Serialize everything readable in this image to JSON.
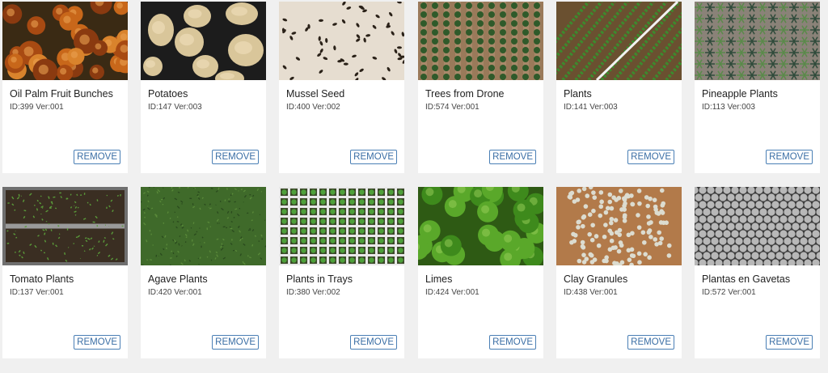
{
  "datasets": [
    {
      "title": "Oil Palm Fruit Bunches",
      "meta": "ID:399 Ver:001",
      "remove_label": "REMOVE",
      "thumb": "oil-palm"
    },
    {
      "title": "Potatoes",
      "meta": "ID:147 Ver:003",
      "remove_label": "REMOVE",
      "thumb": "potatoes"
    },
    {
      "title": "Mussel Seed",
      "meta": "ID:400 Ver:002",
      "remove_label": "REMOVE",
      "thumb": "mussel"
    },
    {
      "title": "Trees from Drone",
      "meta": "ID:574 Ver:001",
      "remove_label": "REMOVE",
      "thumb": "trees"
    },
    {
      "title": "Plants",
      "meta": "ID:141 Ver:003",
      "remove_label": "REMOVE",
      "thumb": "plants"
    },
    {
      "title": "Pineapple Plants",
      "meta": "ID:113 Ver:003",
      "remove_label": "REMOVE",
      "thumb": "pineapple"
    },
    {
      "title": "Tomato Plants",
      "meta": "ID:137 Ver:001",
      "remove_label": "REMOVE",
      "thumb": "tomato"
    },
    {
      "title": "Agave Plants",
      "meta": "ID:420 Ver:001",
      "remove_label": "REMOVE",
      "thumb": "agave"
    },
    {
      "title": "Plants in Trays",
      "meta": "ID:380 Ver:002",
      "remove_label": "REMOVE",
      "thumb": "trays"
    },
    {
      "title": "Limes",
      "meta": "ID:424 Ver:001",
      "remove_label": "REMOVE",
      "thumb": "limes"
    },
    {
      "title": "Clay Granules",
      "meta": "ID:438 Ver:001",
      "remove_label": "REMOVE",
      "thumb": "clay"
    },
    {
      "title": "Plantas en Gavetas",
      "meta": "ID:572 Ver:001",
      "remove_label": "REMOVE",
      "thumb": "gavetas"
    }
  ],
  "colors": {
    "page_bg": "#f0f0f0",
    "card_bg": "#ffffff",
    "button_border": "#4a7fb5",
    "button_text": "#3a6ea5"
  }
}
